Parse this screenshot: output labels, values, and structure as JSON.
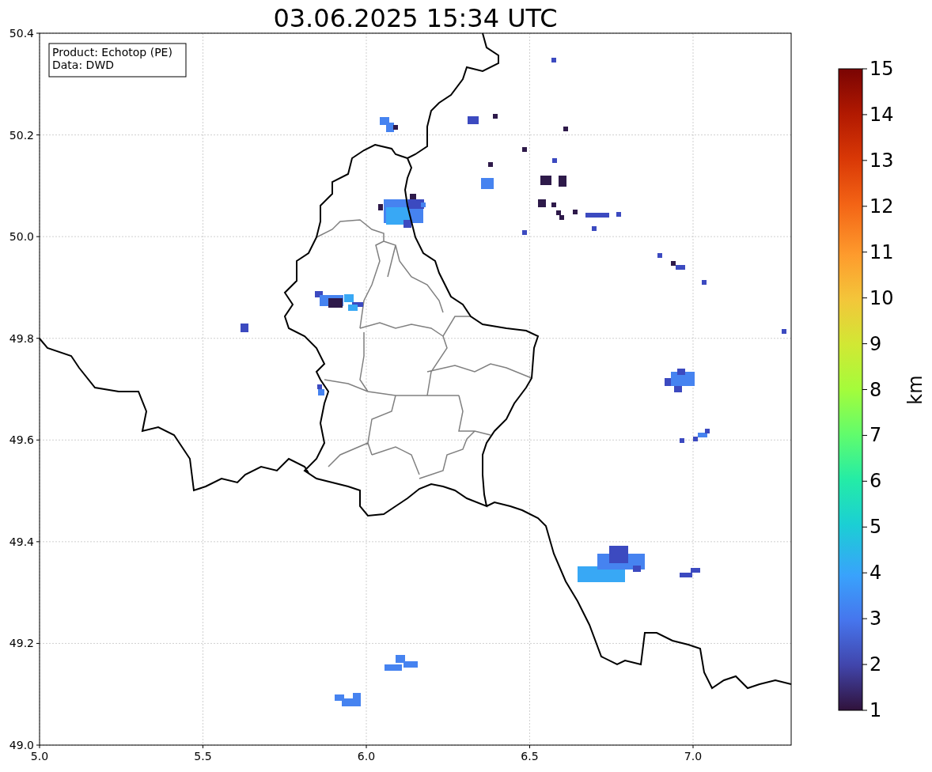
{
  "title": "03.06.2025 15:34 UTC",
  "legend": [
    "Product: Echotop (PE)",
    "Data: DWD"
  ],
  "x_axis": {
    "ticks": [
      "5.0",
      "5.5",
      "6.0",
      "6.5",
      "7.0"
    ]
  },
  "y_axis": {
    "ticks": [
      "50.4",
      "50.2",
      "50.0",
      "49.8",
      "49.6",
      "49.4",
      "49.2",
      "49.0"
    ]
  },
  "colorbar": {
    "label": "km",
    "ticks": [
      "15",
      "14",
      "13",
      "12",
      "11",
      "10",
      "9",
      "8",
      "7",
      "6",
      "5",
      "4",
      "3",
      "2",
      "1"
    ]
  }
}
